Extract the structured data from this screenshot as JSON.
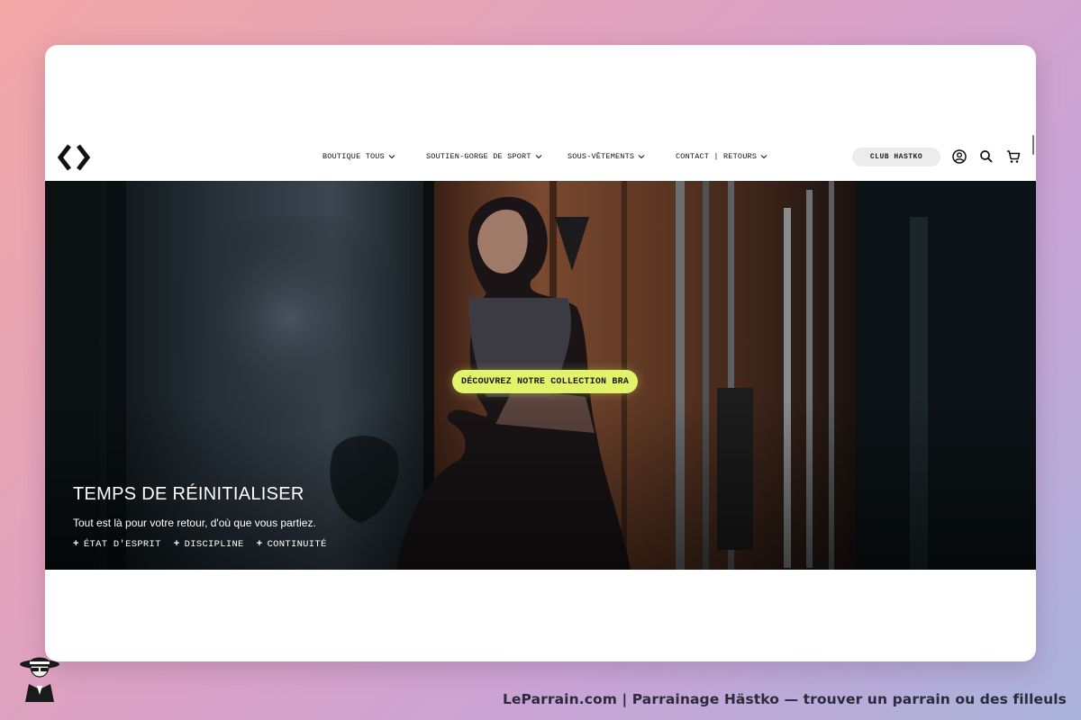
{
  "header": {
    "nav": [
      {
        "label": "BOUTIQUE TOUS"
      },
      {
        "label": "SOUTIEN-GORGE DE SPORT"
      },
      {
        "label": "SOUS-VÊTEMENTS"
      },
      {
        "label": "CONTACT | RETOURS"
      }
    ],
    "club_label": "CLUB HASTKO",
    "icons": [
      "logo-icon",
      "account-icon",
      "search-icon",
      "cart-icon"
    ]
  },
  "hero": {
    "cta_label": "DÉCOUVREZ NOTRE COLLECTION BRA",
    "title": "TEMPS DE RÉINITIALISER",
    "subtitle": "Tout est là pour votre retour, d'où que vous partiez.",
    "tags": [
      "ÉTAT D'ESPRIT",
      "DISCIPLINE",
      "CONTINUITÉ"
    ],
    "tag_glyph": "+",
    "cta_color": "#e2f36b"
  },
  "footer": {
    "text": "LeParrain.com | Parrainage Hästko — trouver un parrain ou des filleuls"
  }
}
